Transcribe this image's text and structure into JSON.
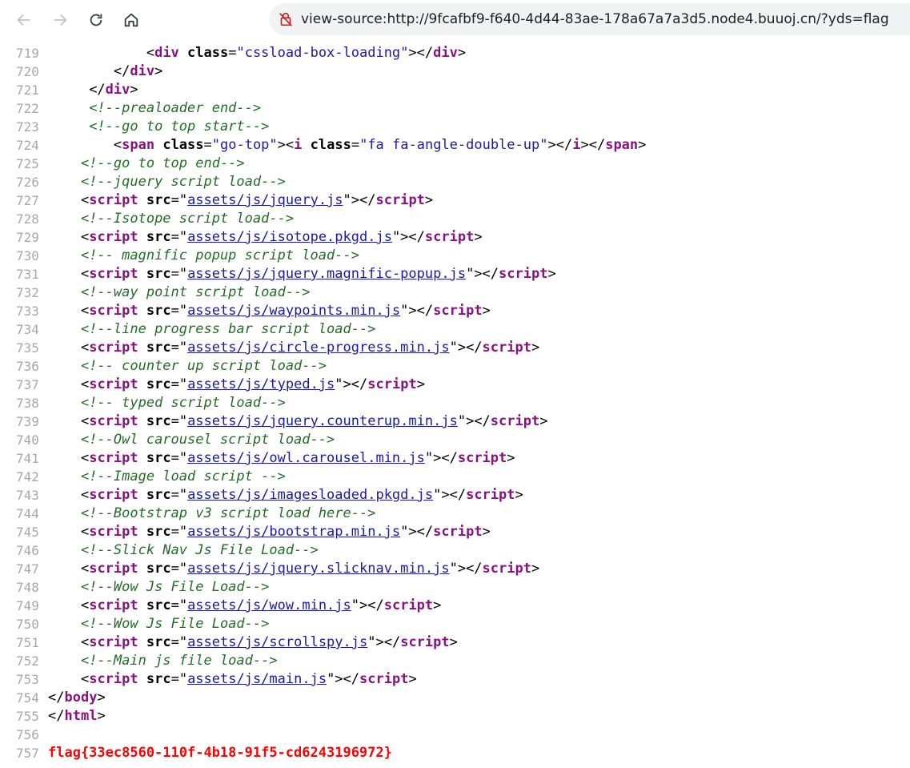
{
  "browser": {
    "url": "view-source:http://9fcafbf9-f640-4d44-83ae-178a67a7a3d5.node4.buuoj.cn/?yds=flag",
    "icons": {
      "back": "arrow-left-icon",
      "forward": "arrow-right-icon",
      "reload": "reload-icon",
      "home": "home-icon",
      "security": "not-secure-icon"
    }
  },
  "source": {
    "lines": [
      {
        "n": "719",
        "indent": "            ",
        "segs": [
          [
            "br",
            "<"
          ],
          [
            "tag",
            "div"
          ],
          [
            "attr",
            " class"
          ],
          [
            "br",
            "="
          ],
          [
            "val",
            "\"cssload-box-loading\""
          ],
          [
            "br",
            ">"
          ],
          [
            "br",
            "</"
          ],
          [
            "tag",
            "div"
          ],
          [
            "br",
            ">"
          ]
        ]
      },
      {
        "n": "720",
        "indent": "        ",
        "segs": [
          [
            "br",
            "</"
          ],
          [
            "tag",
            "div"
          ],
          [
            "br",
            ">"
          ]
        ]
      },
      {
        "n": "721",
        "indent": "     ",
        "segs": [
          [
            "br",
            "</"
          ],
          [
            "tag",
            "div"
          ],
          [
            "br",
            ">"
          ]
        ]
      },
      {
        "n": "722",
        "indent": "     ",
        "segs": [
          [
            "com",
            "<!--prealoader end-->"
          ]
        ]
      },
      {
        "n": "723",
        "indent": "     ",
        "segs": [
          [
            "com",
            "<!--go to top start-->"
          ]
        ]
      },
      {
        "n": "724",
        "indent": "        ",
        "segs": [
          [
            "br",
            "<"
          ],
          [
            "tag",
            "span"
          ],
          [
            "attr",
            " class"
          ],
          [
            "br",
            "="
          ],
          [
            "val",
            "\"go-top\""
          ],
          [
            "br",
            ">"
          ],
          [
            "br",
            "<"
          ],
          [
            "tag",
            "i"
          ],
          [
            "attr",
            " class"
          ],
          [
            "br",
            "="
          ],
          [
            "val",
            "\"fa fa-angle-double-up\""
          ],
          [
            "br",
            ">"
          ],
          [
            "br",
            "</"
          ],
          [
            "tag",
            "i"
          ],
          [
            "br",
            ">"
          ],
          [
            "br",
            "</"
          ],
          [
            "tag",
            "span"
          ],
          [
            "br",
            ">"
          ]
        ]
      },
      {
        "n": "725",
        "indent": "    ",
        "segs": [
          [
            "com",
            "<!--go to top end-->"
          ]
        ]
      },
      {
        "n": "726",
        "indent": "    ",
        "segs": [
          [
            "com",
            "<!--jquery script load-->"
          ]
        ]
      },
      {
        "n": "727",
        "indent": "    ",
        "segs": [
          [
            "br",
            "<"
          ],
          [
            "tag",
            "script"
          ],
          [
            "attr",
            " src"
          ],
          [
            "br",
            "=\""
          ],
          [
            "lnk",
            "assets/js/jquery.js"
          ],
          [
            "br",
            "\">"
          ],
          [
            "br",
            "</"
          ],
          [
            "tag",
            "script"
          ],
          [
            "br",
            ">"
          ]
        ]
      },
      {
        "n": "728",
        "indent": "    ",
        "segs": [
          [
            "com",
            "<!--Isotope script load-->"
          ]
        ]
      },
      {
        "n": "729",
        "indent": "    ",
        "segs": [
          [
            "br",
            "<"
          ],
          [
            "tag",
            "script"
          ],
          [
            "attr",
            " src"
          ],
          [
            "br",
            "=\""
          ],
          [
            "lnk",
            "assets/js/isotope.pkgd.js"
          ],
          [
            "br",
            "\">"
          ],
          [
            "br",
            "</"
          ],
          [
            "tag",
            "script"
          ],
          [
            "br",
            ">"
          ]
        ]
      },
      {
        "n": "730",
        "indent": "    ",
        "segs": [
          [
            "com",
            "<!-- magnific popup script load-->"
          ]
        ]
      },
      {
        "n": "731",
        "indent": "    ",
        "segs": [
          [
            "br",
            "<"
          ],
          [
            "tag",
            "script"
          ],
          [
            "attr",
            " src"
          ],
          [
            "br",
            "=\""
          ],
          [
            "lnk",
            "assets/js/jquery.magnific-popup.js"
          ],
          [
            "br",
            "\">"
          ],
          [
            "br",
            "</"
          ],
          [
            "tag",
            "script"
          ],
          [
            "br",
            ">"
          ]
        ]
      },
      {
        "n": "732",
        "indent": "    ",
        "segs": [
          [
            "com",
            "<!--way point script load-->"
          ]
        ]
      },
      {
        "n": "733",
        "indent": "    ",
        "segs": [
          [
            "br",
            "<"
          ],
          [
            "tag",
            "script"
          ],
          [
            "attr",
            " src"
          ],
          [
            "br",
            "=\""
          ],
          [
            "lnk",
            "assets/js/waypoints.min.js"
          ],
          [
            "br",
            "\">"
          ],
          [
            "br",
            "</"
          ],
          [
            "tag",
            "script"
          ],
          [
            "br",
            ">"
          ]
        ]
      },
      {
        "n": "734",
        "indent": "    ",
        "segs": [
          [
            "com",
            "<!--line progress bar script load-->"
          ]
        ]
      },
      {
        "n": "735",
        "indent": "    ",
        "segs": [
          [
            "br",
            "<"
          ],
          [
            "tag",
            "script"
          ],
          [
            "attr",
            " src"
          ],
          [
            "br",
            "=\""
          ],
          [
            "lnk",
            "assets/js/circle-progress.min.js"
          ],
          [
            "br",
            "\">"
          ],
          [
            "br",
            "</"
          ],
          [
            "tag",
            "script"
          ],
          [
            "br",
            ">"
          ]
        ]
      },
      {
        "n": "736",
        "indent": "    ",
        "segs": [
          [
            "com",
            "<!-- counter up script load-->"
          ]
        ]
      },
      {
        "n": "737",
        "indent": "    ",
        "segs": [
          [
            "br",
            "<"
          ],
          [
            "tag",
            "script"
          ],
          [
            "attr",
            " src"
          ],
          [
            "br",
            "=\""
          ],
          [
            "lnk",
            "assets/js/typed.js"
          ],
          [
            "br",
            "\">"
          ],
          [
            "br",
            "</"
          ],
          [
            "tag",
            "script"
          ],
          [
            "br",
            ">"
          ]
        ]
      },
      {
        "n": "738",
        "indent": "    ",
        "segs": [
          [
            "com",
            "<!-- typed script load-->"
          ]
        ]
      },
      {
        "n": "739",
        "indent": "    ",
        "segs": [
          [
            "br",
            "<"
          ],
          [
            "tag",
            "script"
          ],
          [
            "attr",
            " src"
          ],
          [
            "br",
            "=\""
          ],
          [
            "lnk",
            "assets/js/jquery.counterup.min.js"
          ],
          [
            "br",
            "\">"
          ],
          [
            "br",
            "</"
          ],
          [
            "tag",
            "script"
          ],
          [
            "br",
            ">"
          ]
        ]
      },
      {
        "n": "740",
        "indent": "    ",
        "segs": [
          [
            "com",
            "<!--Owl carousel script load-->"
          ]
        ]
      },
      {
        "n": "741",
        "indent": "    ",
        "segs": [
          [
            "br",
            "<"
          ],
          [
            "tag",
            "script"
          ],
          [
            "attr",
            " src"
          ],
          [
            "br",
            "=\""
          ],
          [
            "lnk",
            "assets/js/owl.carousel.min.js"
          ],
          [
            "br",
            "\">"
          ],
          [
            "br",
            "</"
          ],
          [
            "tag",
            "script"
          ],
          [
            "br",
            ">"
          ]
        ]
      },
      {
        "n": "742",
        "indent": "    ",
        "segs": [
          [
            "com",
            "<!--Image load script -->"
          ]
        ]
      },
      {
        "n": "743",
        "indent": "    ",
        "segs": [
          [
            "br",
            "<"
          ],
          [
            "tag",
            "script"
          ],
          [
            "attr",
            " src"
          ],
          [
            "br",
            "=\""
          ],
          [
            "lnk",
            "assets/js/imagesloaded.pkgd.js"
          ],
          [
            "br",
            "\">"
          ],
          [
            "br",
            "</"
          ],
          [
            "tag",
            "script"
          ],
          [
            "br",
            ">"
          ]
        ]
      },
      {
        "n": "744",
        "indent": "    ",
        "segs": [
          [
            "com",
            "<!--Bootstrap v3 script load here-->"
          ]
        ]
      },
      {
        "n": "745",
        "indent": "    ",
        "segs": [
          [
            "br",
            "<"
          ],
          [
            "tag",
            "script"
          ],
          [
            "attr",
            " src"
          ],
          [
            "br",
            "=\""
          ],
          [
            "lnk",
            "assets/js/bootstrap.min.js"
          ],
          [
            "br",
            "\">"
          ],
          [
            "br",
            "</"
          ],
          [
            "tag",
            "script"
          ],
          [
            "br",
            ">"
          ]
        ]
      },
      {
        "n": "746",
        "indent": "    ",
        "segs": [
          [
            "com",
            "<!--Slick Nav Js File Load-->"
          ]
        ]
      },
      {
        "n": "747",
        "indent": "    ",
        "segs": [
          [
            "br",
            "<"
          ],
          [
            "tag",
            "script"
          ],
          [
            "attr",
            " src"
          ],
          [
            "br",
            "=\""
          ],
          [
            "lnk",
            "assets/js/jquery.slicknav.min.js"
          ],
          [
            "br",
            "\">"
          ],
          [
            "br",
            "</"
          ],
          [
            "tag",
            "script"
          ],
          [
            "br",
            ">"
          ]
        ]
      },
      {
        "n": "748",
        "indent": "    ",
        "segs": [
          [
            "com",
            "<!--Wow Js File Load-->"
          ]
        ]
      },
      {
        "n": "749",
        "indent": "    ",
        "segs": [
          [
            "br",
            "<"
          ],
          [
            "tag",
            "script"
          ],
          [
            "attr",
            " src"
          ],
          [
            "br",
            "=\""
          ],
          [
            "lnk",
            "assets/js/wow.min.js"
          ],
          [
            "br",
            "\">"
          ],
          [
            "br",
            "</"
          ],
          [
            "tag",
            "script"
          ],
          [
            "br",
            ">"
          ]
        ]
      },
      {
        "n": "750",
        "indent": "    ",
        "segs": [
          [
            "com",
            "<!--Wow Js File Load-->"
          ]
        ]
      },
      {
        "n": "751",
        "indent": "    ",
        "segs": [
          [
            "br",
            "<"
          ],
          [
            "tag",
            "script"
          ],
          [
            "attr",
            " src"
          ],
          [
            "br",
            "=\""
          ],
          [
            "lnk",
            "assets/js/scrollspy.js"
          ],
          [
            "br",
            "\">"
          ],
          [
            "br",
            "</"
          ],
          [
            "tag",
            "script"
          ],
          [
            "br",
            ">"
          ]
        ]
      },
      {
        "n": "752",
        "indent": "    ",
        "segs": [
          [
            "com",
            "<!--Main js file load-->"
          ]
        ]
      },
      {
        "n": "753",
        "indent": "    ",
        "segs": [
          [
            "br",
            "<"
          ],
          [
            "tag",
            "script"
          ],
          [
            "attr",
            " src"
          ],
          [
            "br",
            "=\""
          ],
          [
            "lnk",
            "assets/js/main.js"
          ],
          [
            "br",
            "\">"
          ],
          [
            "br",
            "</"
          ],
          [
            "tag",
            "script"
          ],
          [
            "br",
            ">"
          ]
        ]
      },
      {
        "n": "754",
        "indent": "",
        "segs": [
          [
            "br",
            "</"
          ],
          [
            "tag",
            "body"
          ],
          [
            "br",
            ">"
          ]
        ]
      },
      {
        "n": "755",
        "indent": "",
        "segs": [
          [
            "br",
            "</"
          ],
          [
            "tag",
            "html"
          ],
          [
            "br",
            ">"
          ]
        ]
      },
      {
        "n": "756",
        "indent": "",
        "segs": []
      },
      {
        "n": "757",
        "indent": "",
        "segs": [
          [
            "flag",
            "flag{33ec8560-110f-4b18-91f5-cd6243196972}"
          ]
        ]
      }
    ]
  }
}
